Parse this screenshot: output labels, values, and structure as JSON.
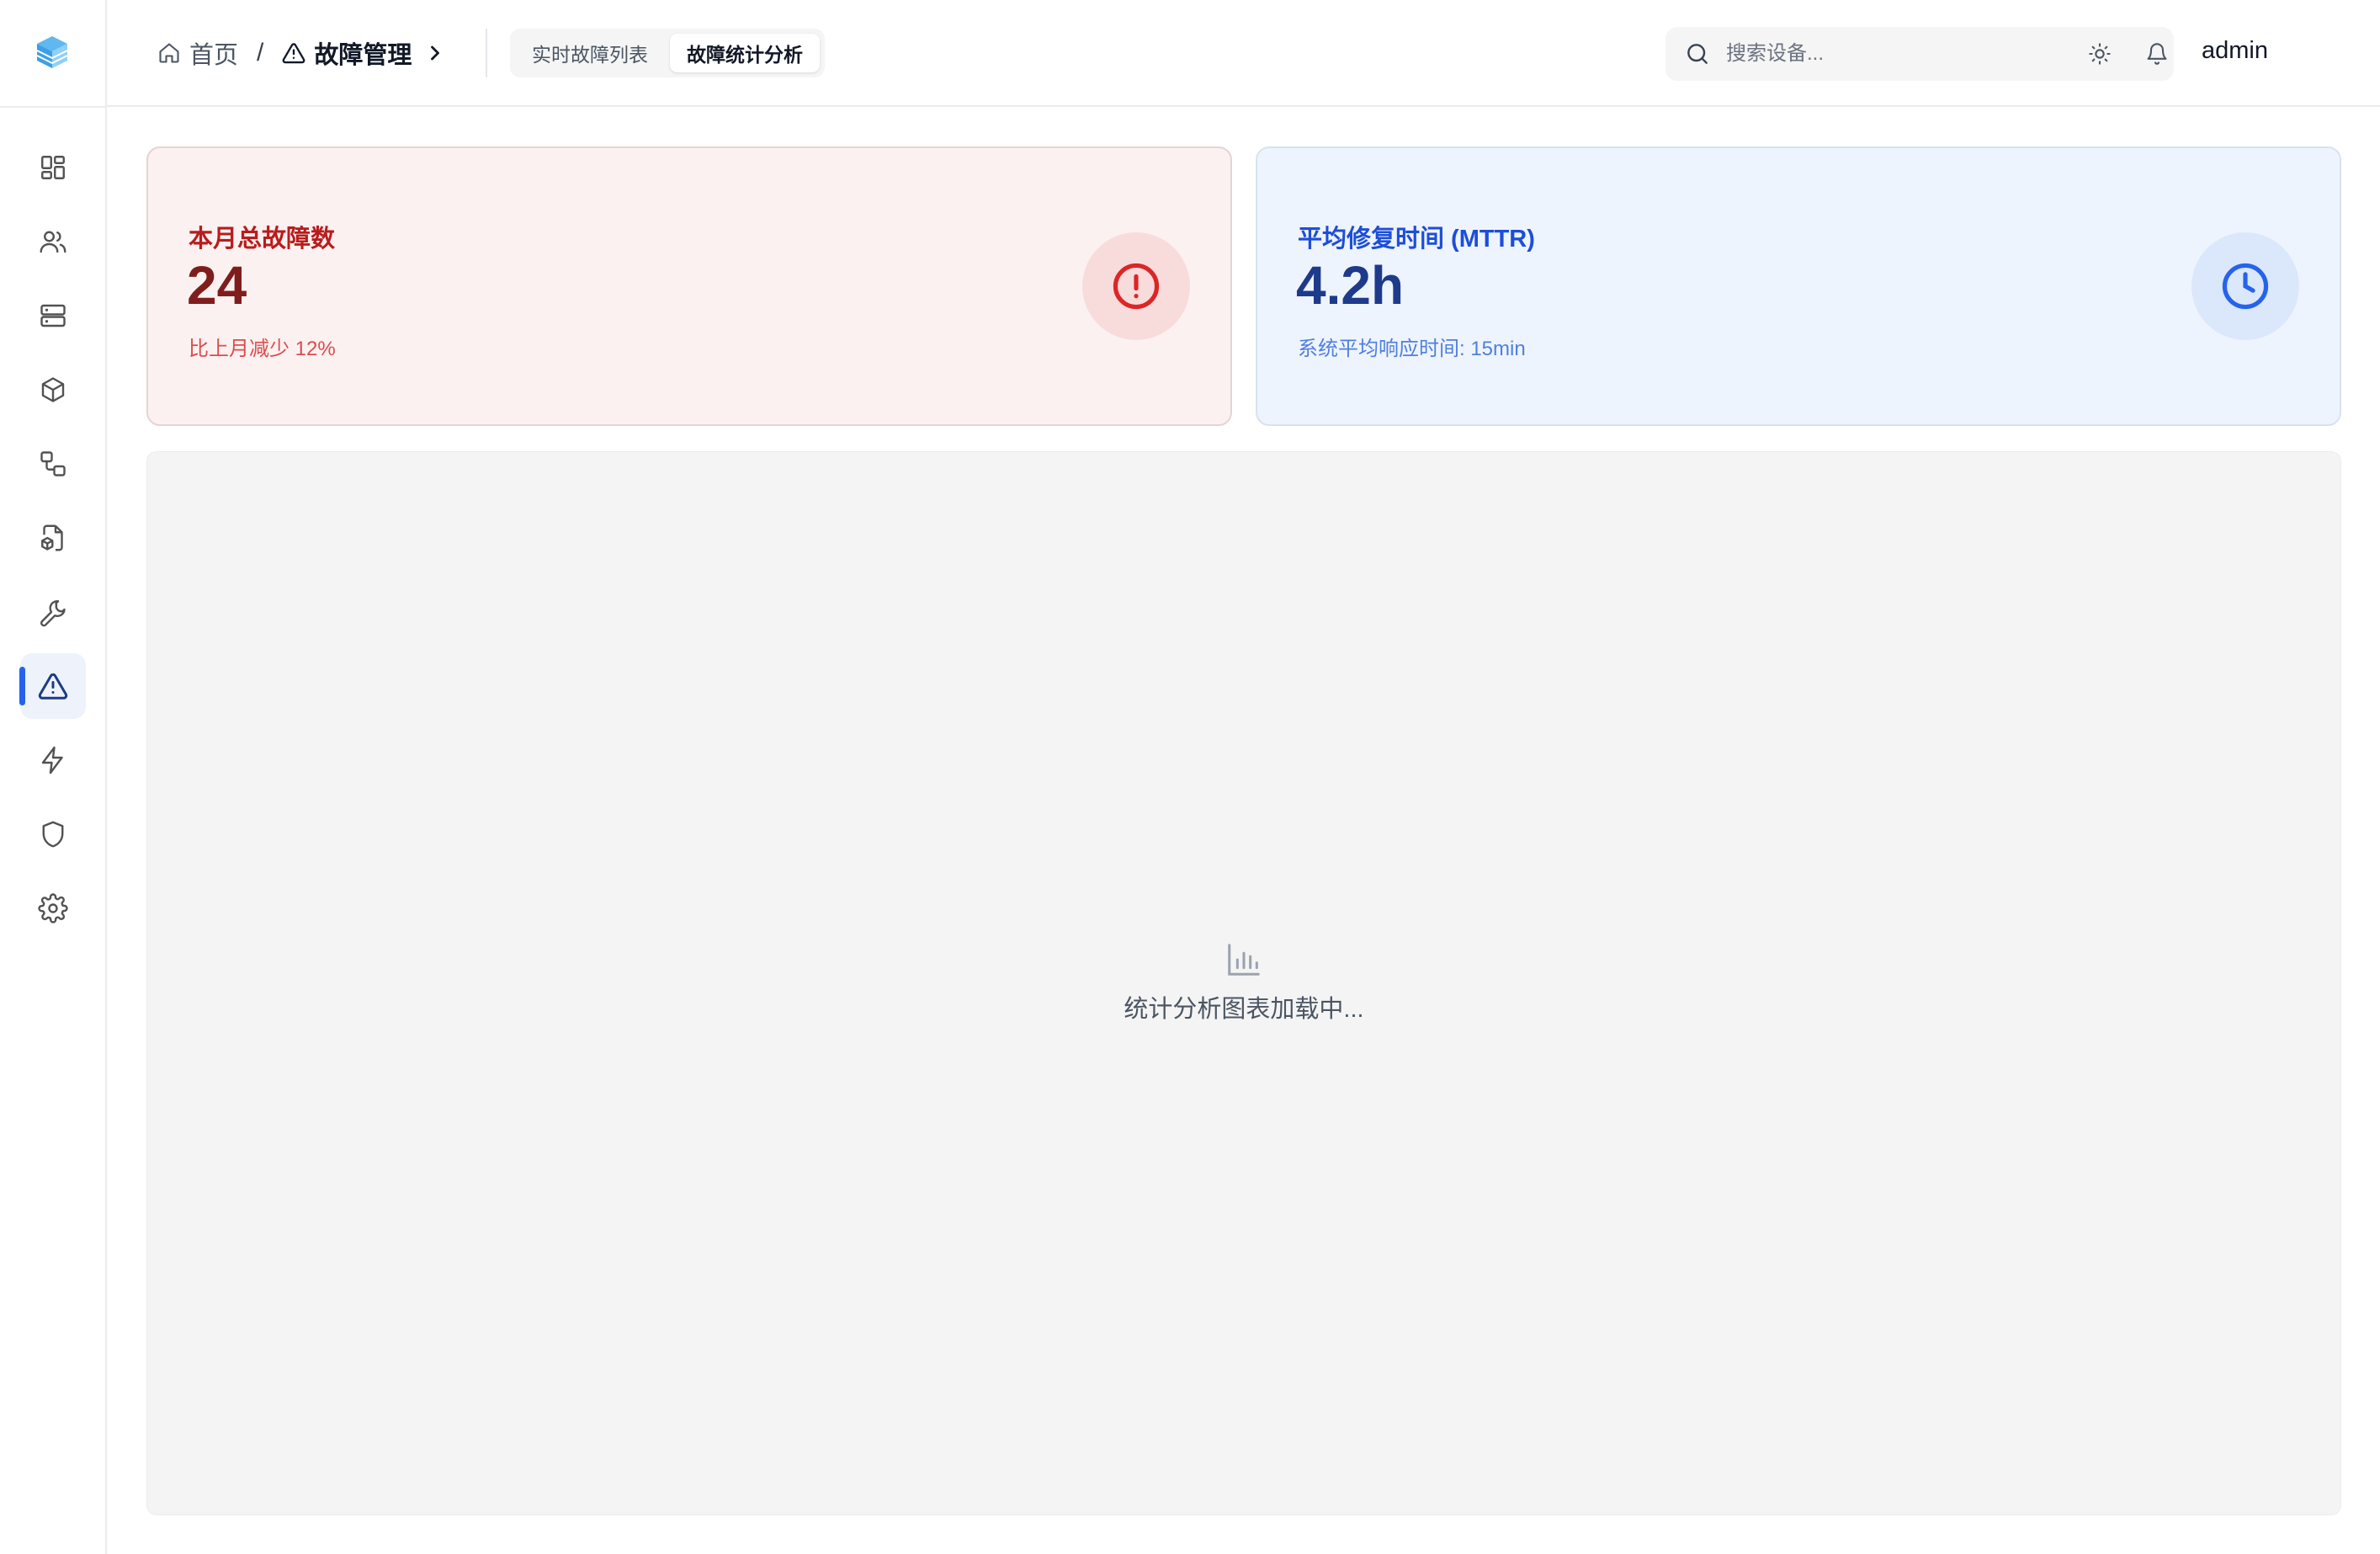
{
  "header": {
    "breadcrumb": {
      "home": "首页",
      "separator": "/",
      "current": "故障管理"
    },
    "tabs": [
      {
        "label": "实时故障列表",
        "active": false
      },
      {
        "label": "故障统计分析",
        "active": true
      }
    ],
    "search": {
      "placeholder": "搜索设备..."
    },
    "user": {
      "name": "admin"
    }
  },
  "sidebar": {
    "items": [
      {
        "name": "dashboard",
        "icon": "grid-icon",
        "active": false
      },
      {
        "name": "users",
        "icon": "users-icon",
        "active": false
      },
      {
        "name": "servers",
        "icon": "server-icon",
        "active": false
      },
      {
        "name": "devices",
        "icon": "cube-icon",
        "active": false
      },
      {
        "name": "workflow",
        "icon": "flow-icon",
        "active": false
      },
      {
        "name": "device-files",
        "icon": "file-box-icon",
        "active": false
      },
      {
        "name": "maintenance",
        "icon": "wrench-icon",
        "active": false
      },
      {
        "name": "faults",
        "icon": "alert-triangle-icon",
        "active": true
      },
      {
        "name": "power",
        "icon": "lightning-icon",
        "active": false
      },
      {
        "name": "security",
        "icon": "shield-icon",
        "active": false
      },
      {
        "name": "settings",
        "icon": "gear-icon",
        "active": false
      }
    ]
  },
  "stats": {
    "faults": {
      "label": "本月总故障数",
      "value": "24",
      "sub": "比上月减少 12%",
      "icon": "alert-circle-icon",
      "accent": "#dc2626"
    },
    "mttr": {
      "label": "平均修复时间 (MTTR)",
      "value": "4.2h",
      "sub": "系统平均响应时间: 15min",
      "icon": "clock-icon",
      "accent": "#2563eb"
    }
  },
  "chart_panel": {
    "loading_text": "统计分析图表加载中...",
    "icon": "bar-chart-icon"
  }
}
